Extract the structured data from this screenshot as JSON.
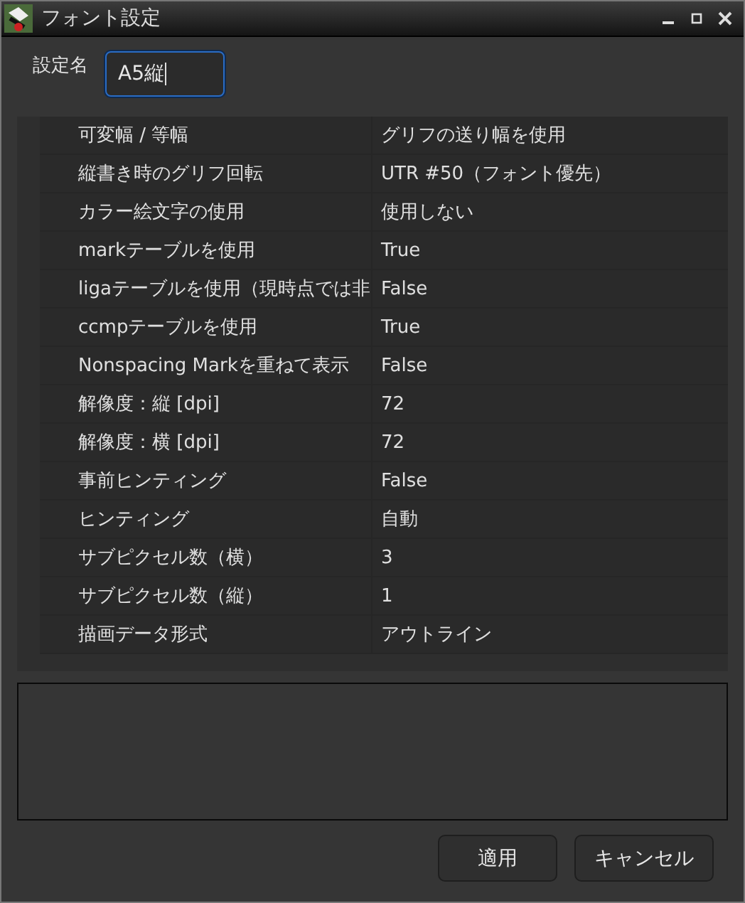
{
  "window": {
    "title": "フォント設定"
  },
  "name_field": {
    "label": "設定名",
    "value": "A5縦"
  },
  "properties": [
    {
      "name": "可変幅 / 等幅",
      "value": "グリフの送り幅を使用"
    },
    {
      "name": "縦書き時のグリフ回転",
      "value": "UTR #50（フォント優先）"
    },
    {
      "name": "カラー絵文字の使用",
      "value": "使用しない"
    },
    {
      "name": "markテーブルを使用",
      "value": "True"
    },
    {
      "name": "ligaテーブルを使用（現時点では非",
      "value": "False"
    },
    {
      "name": "ccmpテーブルを使用",
      "value": "True"
    },
    {
      "name": "Nonspacing Markを重ねて表示",
      "value": "False"
    },
    {
      "name": "解像度：縦 [dpi]",
      "value": "72"
    },
    {
      "name": "解像度：横 [dpi]",
      "value": "72"
    },
    {
      "name": "事前ヒンティング",
      "value": "False"
    },
    {
      "name": "ヒンティング",
      "value": "自動"
    },
    {
      "name": "サブピクセル数（横）",
      "value": "3"
    },
    {
      "name": "サブピクセル数（縦）",
      "value": "1"
    },
    {
      "name": "描画データ形式",
      "value": "アウトライン"
    }
  ],
  "buttons": [
    "適用",
    "キャンセル"
  ]
}
